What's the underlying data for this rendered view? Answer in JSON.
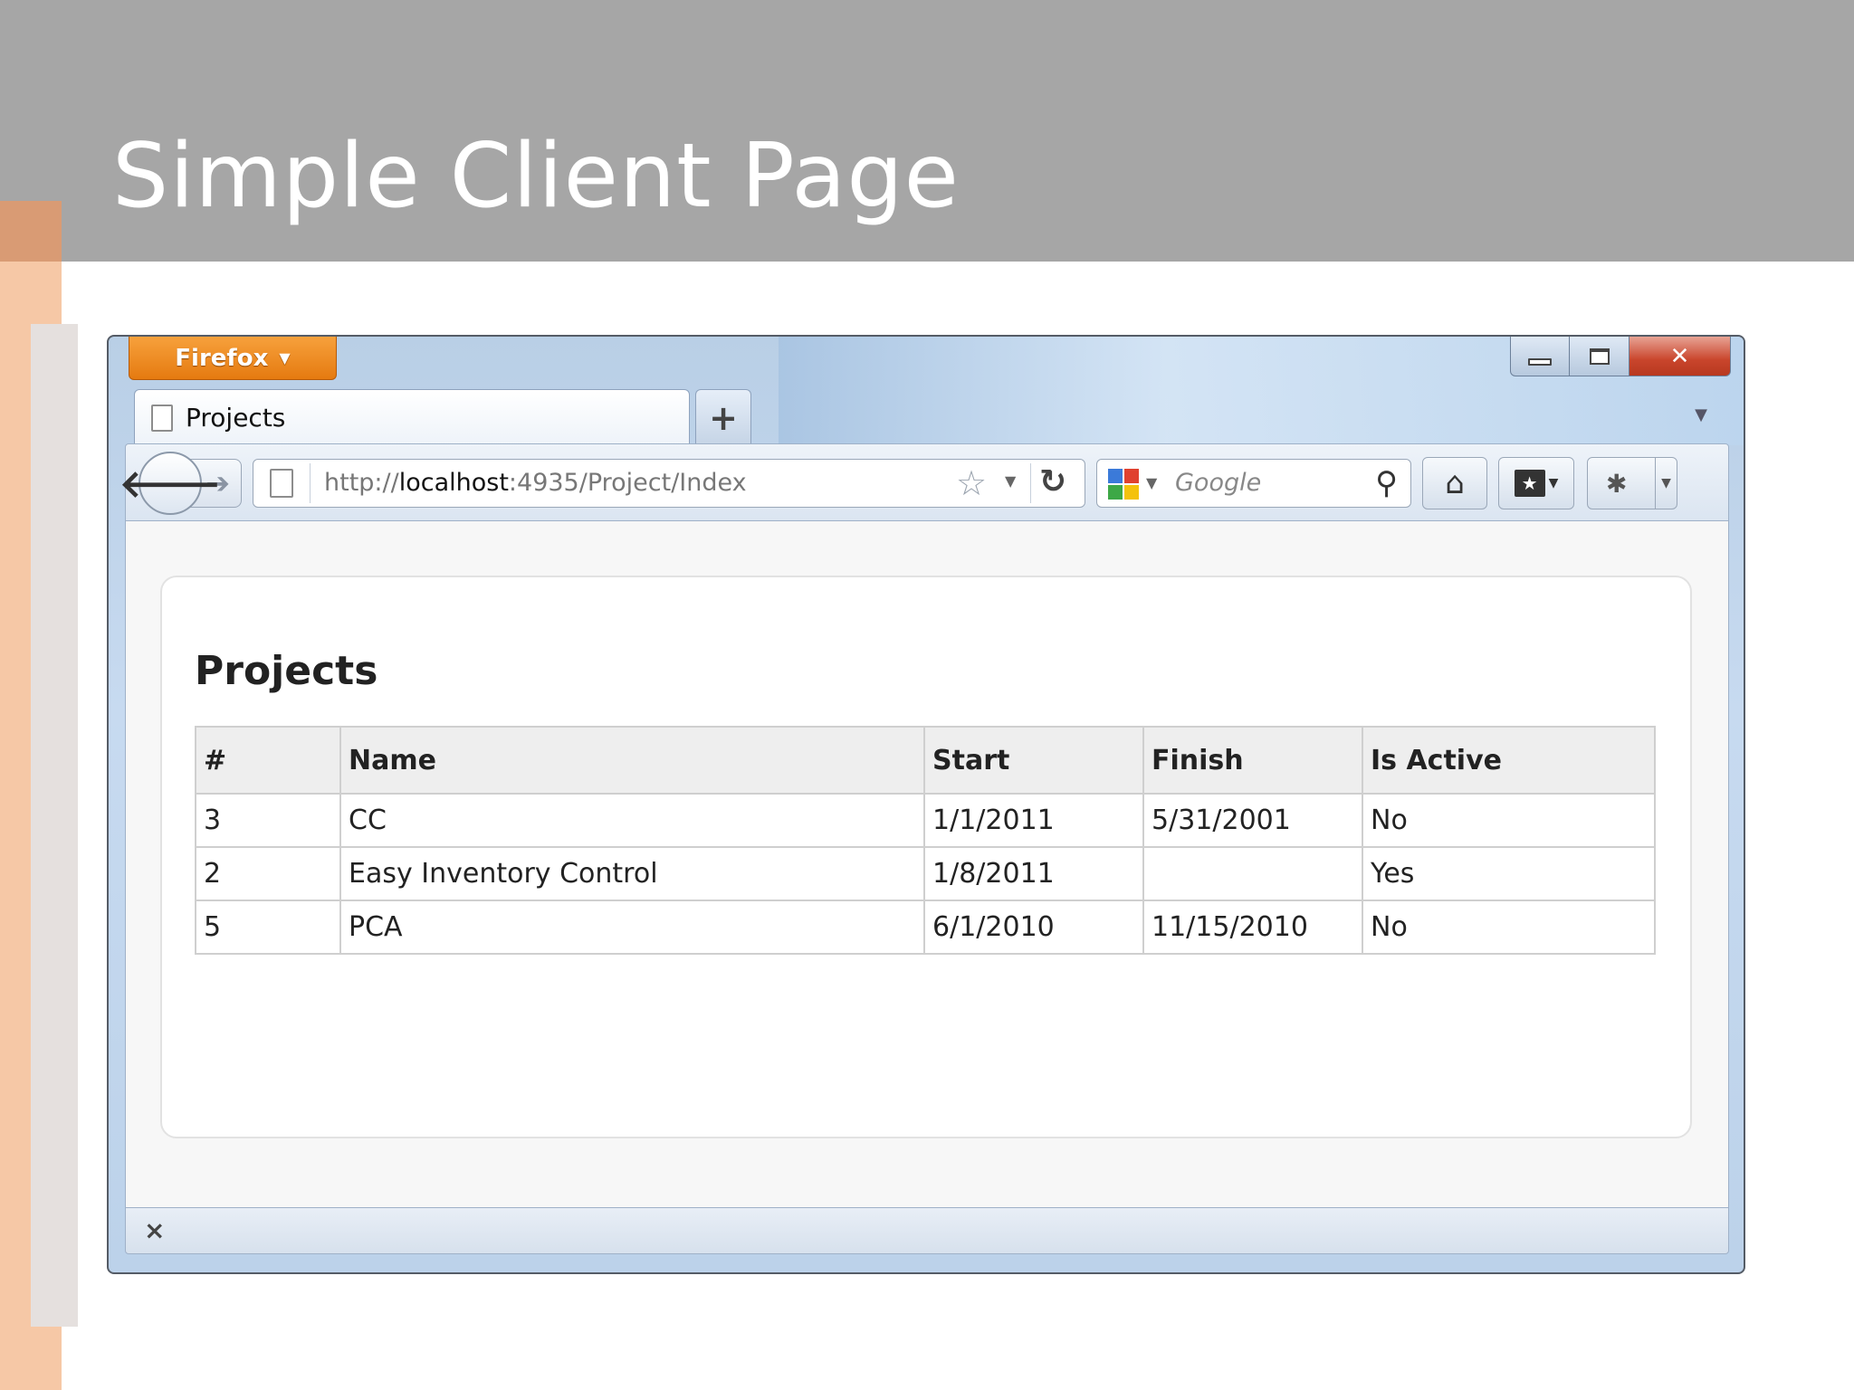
{
  "slide": {
    "title": "Simple Client Page"
  },
  "browser": {
    "menu_button_label": "Firefox",
    "tab": {
      "label": "Projects"
    },
    "url": {
      "prefix": "http://",
      "host": "localhost",
      "rest": ":4935/Project/Index"
    },
    "search": {
      "placeholder": "Google"
    },
    "icons": {
      "page": "page-icon",
      "back": "back-arrow-icon",
      "forward": "forward-arrow-icon",
      "star": "star-icon",
      "reload": "reload-icon",
      "search": "magnifier-icon",
      "home": "home-icon",
      "bookmarks": "bookmarks-icon",
      "addon": "addon-icon",
      "close": "close-icon"
    }
  },
  "page": {
    "heading": "Projects",
    "table": {
      "headers": [
        "#",
        "Name",
        "Start",
        "Finish",
        "Is Active"
      ],
      "rows": [
        [
          "3",
          "CC",
          "1/1/2011",
          "5/31/2001",
          "No"
        ],
        [
          "2",
          "Easy Inventory Control",
          "1/8/2011",
          "",
          "Yes"
        ],
        [
          "5",
          "PCA",
          "6/1/2010",
          "11/15/2010",
          "No"
        ]
      ]
    }
  },
  "colors": {
    "header_gray": "#a6a6a6",
    "accent_peach": "#f6c8a6",
    "firefox_orange": "#e57a10",
    "close_red": "#c9452c"
  }
}
